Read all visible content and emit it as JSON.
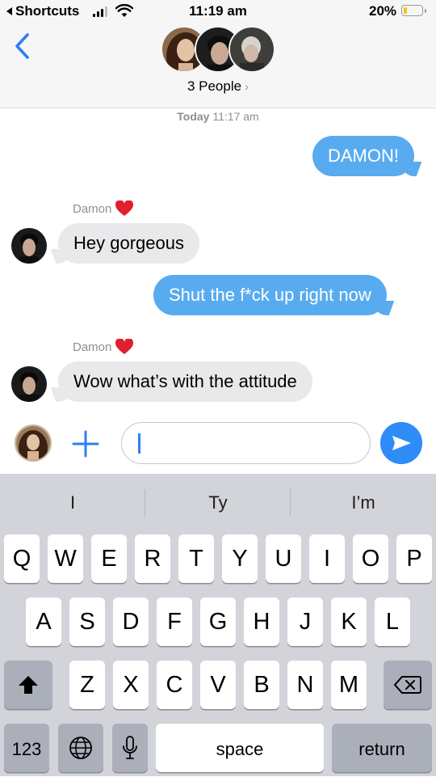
{
  "status_bar": {
    "back_label": "Shortcuts",
    "time": "11:19 am",
    "battery_percent": "20%",
    "battery_level": 0.2,
    "battery_color": "#f2c40f"
  },
  "header": {
    "back_icon": "chevron-left",
    "group_label": "3 People",
    "group_chevron": "›",
    "accent_color": "#2f7ff4"
  },
  "conversation": {
    "timestamp_day": "Today",
    "timestamp_time": "11:17 am",
    "messages": [
      {
        "direction": "outgoing",
        "text": "DAMON!"
      },
      {
        "direction": "incoming",
        "sender": "Damon",
        "text": "Hey gorgeous"
      },
      {
        "direction": "outgoing",
        "text": "Shut the f*ck up right now"
      },
      {
        "direction": "incoming",
        "sender": "Damon",
        "text": "Wow what’s with the attitude"
      }
    ],
    "outgoing_color": "#59abf0",
    "incoming_color": "#e9e9eb"
  },
  "compose": {
    "value": "",
    "plus_icon": "plus-icon",
    "send_icon": "send-arrow-icon"
  },
  "keyboard": {
    "suggestions": [
      "I",
      "Ty",
      "I’m"
    ],
    "row1": [
      "Q",
      "W",
      "E",
      "R",
      "T",
      "Y",
      "U",
      "I",
      "O",
      "P"
    ],
    "row2": [
      "A",
      "S",
      "D",
      "F",
      "G",
      "H",
      "J",
      "K",
      "L"
    ],
    "row3": [
      "Z",
      "X",
      "C",
      "V",
      "B",
      "N",
      "M"
    ],
    "numbers_label": "123",
    "space_label": "space",
    "return_label": "return"
  }
}
